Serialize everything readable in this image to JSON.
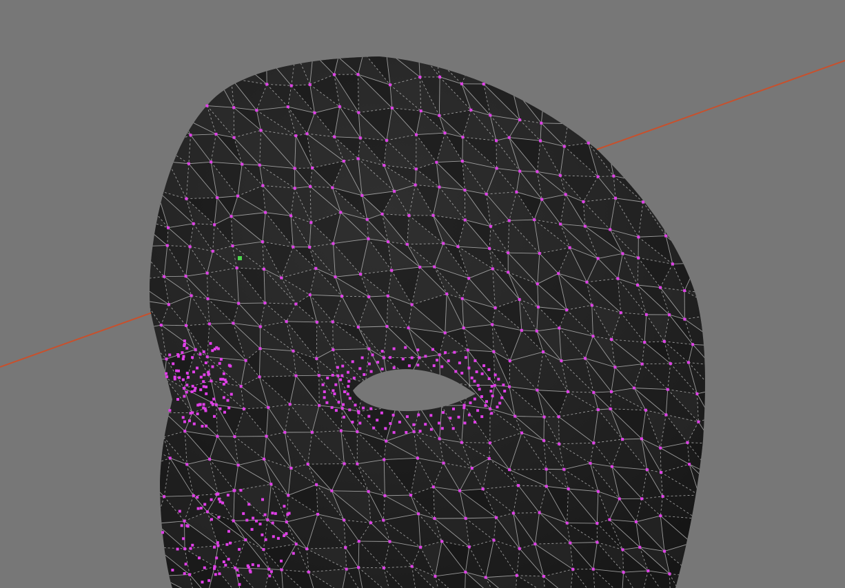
{
  "viewport": {
    "background_color": "#777777",
    "view_mode": "wireframe-vertex-overlay"
  },
  "axis": {
    "color": "#c8502c"
  },
  "mesh": {
    "object": "face-mesh",
    "surface_color": "#262626",
    "wire_color": "#c6c6c6",
    "vertex_color": "#e040e8",
    "selected_vertex_color": "#4cd64c"
  }
}
